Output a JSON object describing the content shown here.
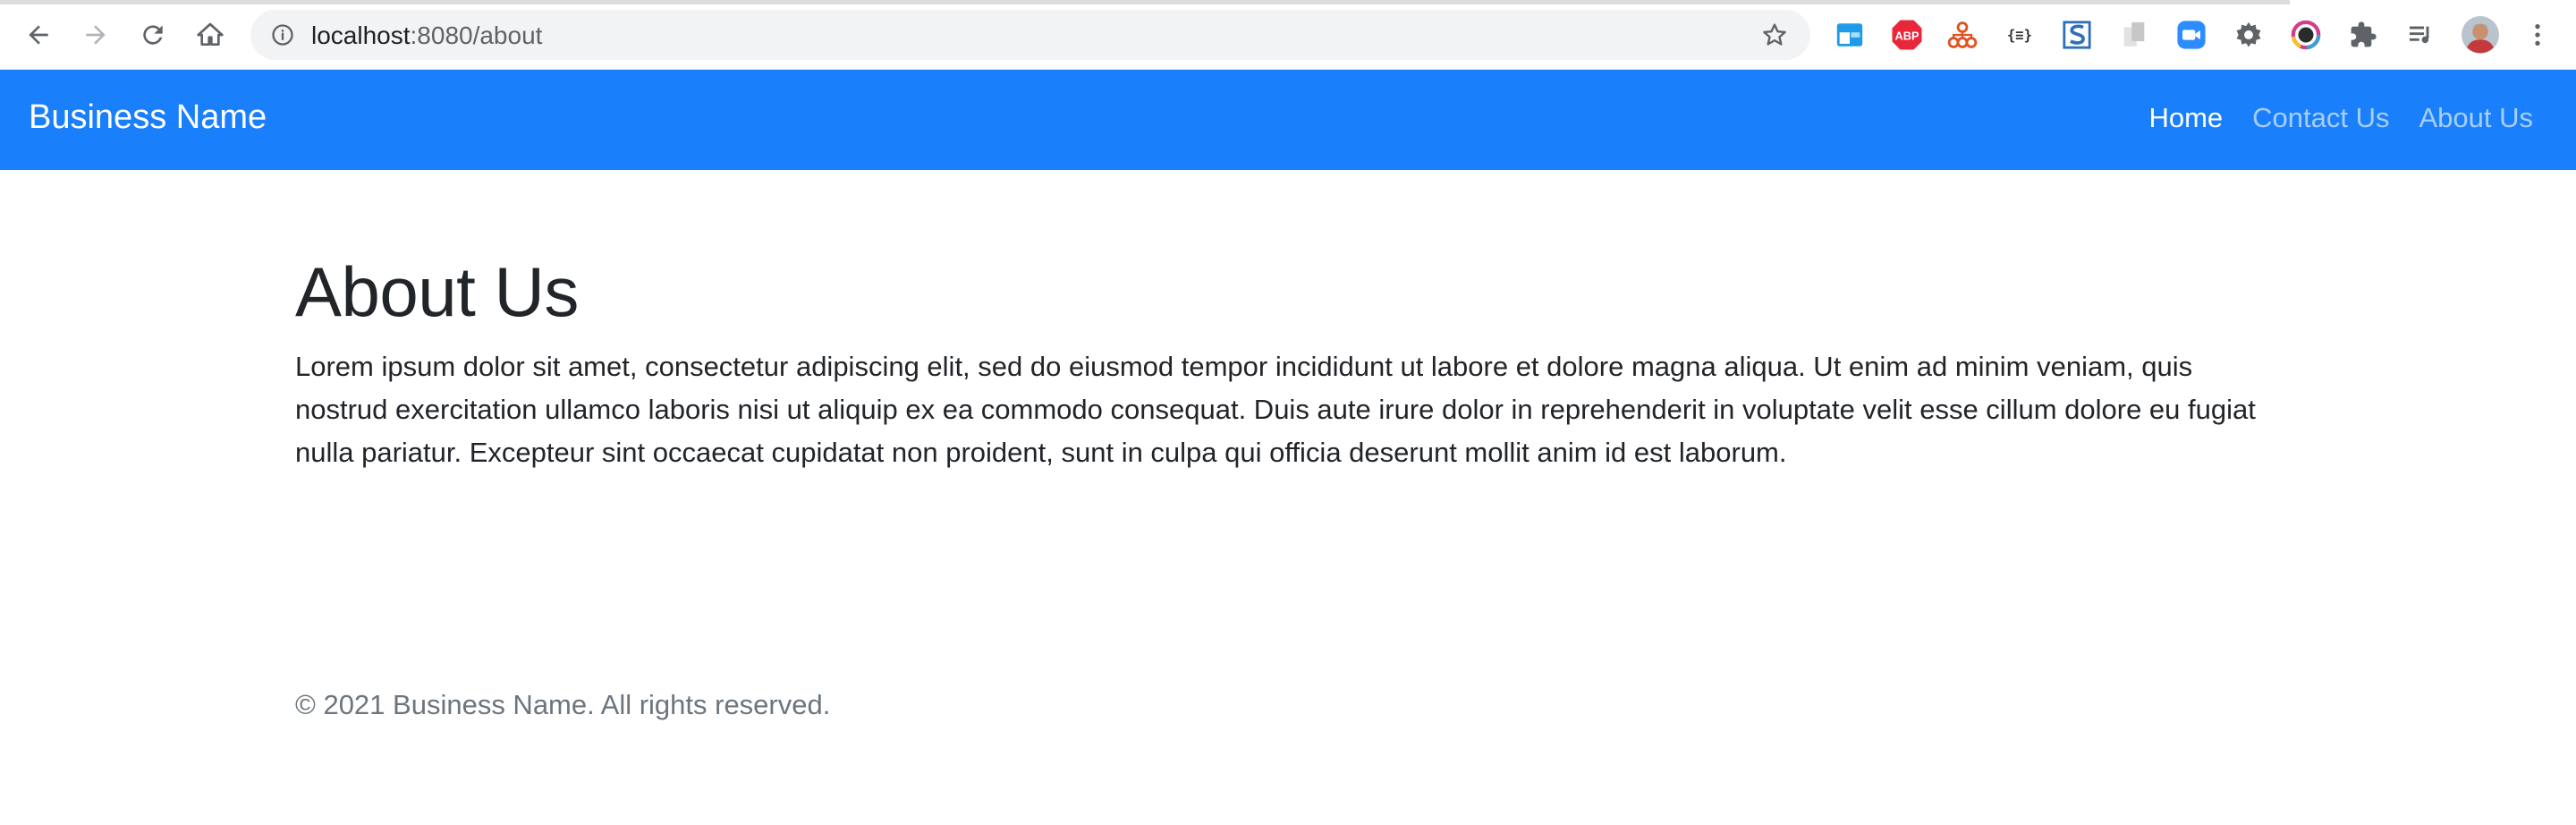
{
  "browser": {
    "url_host": "localhost",
    "url_rest": ":8080/about",
    "extensions": [
      {
        "name": "tab-extension-icon",
        "color": "#1e9be8"
      },
      {
        "name": "adblock-plus-icon",
        "label": "ABP",
        "color": "#e8273a"
      },
      {
        "name": "org-chart-extension-icon",
        "color": "#e0521f"
      },
      {
        "name": "json-formatter-icon",
        "label": "{≡}",
        "color": "#333333"
      },
      {
        "name": "s-extension-icon",
        "label": "S",
        "color": "#2f6fb8"
      },
      {
        "name": "book-extension-icon",
        "color": "#c7c7c7"
      },
      {
        "name": "zoom-icon",
        "color": "#2d8cff"
      },
      {
        "name": "gear-extension-icon",
        "color": "#5f6368"
      },
      {
        "name": "color-picker-icon",
        "color": "#d23c8c"
      },
      {
        "name": "puzzle-icon",
        "color": "#5f6368"
      },
      {
        "name": "media-queue-icon",
        "color": "#5f6368"
      }
    ]
  },
  "site": {
    "brand": "Business Name",
    "nav": {
      "home": "Home",
      "contact": "Contact Us",
      "about": "About Us"
    }
  },
  "main": {
    "heading": "About Us",
    "body": "Lorem ipsum dolor sit amet, consectetur adipiscing elit, sed do eiusmod tempor incididunt ut labore et dolore magna aliqua. Ut enim ad minim veniam, quis nostrud exercitation ullamco laboris nisi ut aliquip ex ea commodo consequat. Duis aute irure dolor in reprehenderit in voluptate velit esse cillum dolore eu fugiat nulla pariatur. Excepteur sint occaecat cupidatat non proident, sunt in culpa qui officia deserunt mollit anim id est laborum."
  },
  "footer": {
    "text": "© 2021 Business Name. All rights reserved."
  },
  "colors": {
    "navbar": "#1a7ffb",
    "text": "#212529",
    "muted": "#6c757d"
  }
}
